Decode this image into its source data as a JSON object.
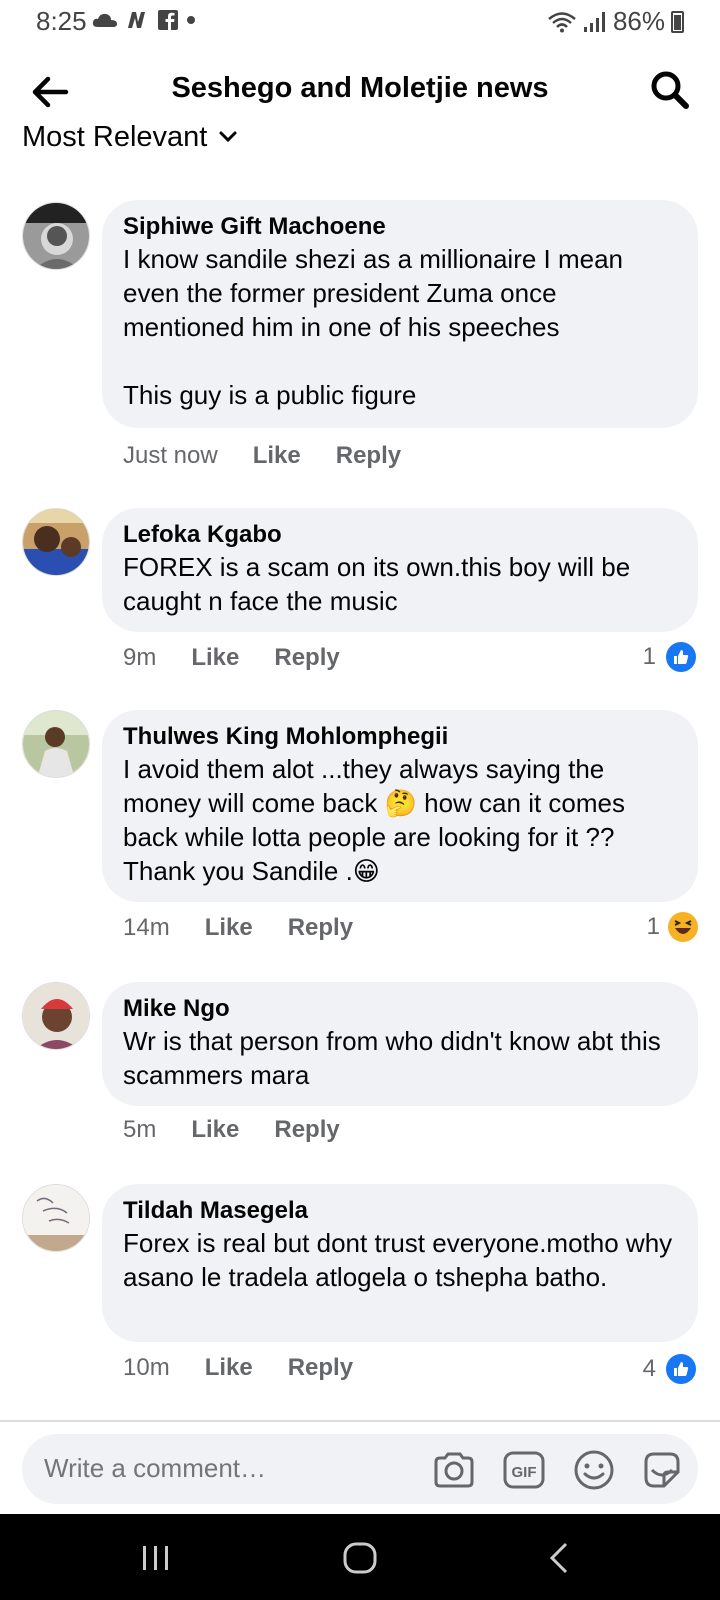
{
  "status_bar": {
    "time": "8:25",
    "battery": "86%"
  },
  "header": {
    "title": "Seshego and Moletjie news",
    "back_icon": "arrow-left-icon",
    "search_icon": "search-icon"
  },
  "sort": {
    "label": "Most Relevant"
  },
  "comments": [
    {
      "name": "Siphiwe Gift Machoene",
      "text": "I know sandile shezi as a millionaire I mean even the former president Zuma once mentioned him in one of his speeches\n\nThis guy is a public figure",
      "time": "Just now",
      "like": "Like",
      "reply": "Reply",
      "reaction_count": ""
    },
    {
      "name": "Lefoka Kgabo",
      "text": "FOREX is a scam on its own.this boy will be caught n face the music",
      "time": "9m",
      "like": "Like",
      "reply": "Reply",
      "reaction_count": "1",
      "reaction": "like"
    },
    {
      "name": "Thulwes King Mohlomphegii",
      "text": "I avoid them alot ...they always saying the money will come back 🤔 how can it comes back while lotta people are looking for it ?? Thank you Sandile .😁",
      "time": "14m",
      "like": "Like",
      "reply": "Reply",
      "reaction_count": "1",
      "reaction": "haha"
    },
    {
      "name": "Mike Ngo",
      "text": "Wr is that person from who didn't know abt this scammers mara",
      "time": "5m",
      "like": "Like",
      "reply": "Reply",
      "reaction_count": ""
    },
    {
      "name": "Tildah Masegela",
      "text": "Forex is real but dont trust everyone.motho why asano le tradela atlogela o tshepha batho.",
      "time": "10m",
      "like": "Like",
      "reply": "Reply",
      "reaction_count": "4",
      "reaction": "like"
    }
  ],
  "composer": {
    "placeholder": "Write a comment…"
  },
  "colors": {
    "accent": "#1877f2",
    "bubble": "#f0f2f5",
    "meta_text": "#65676b"
  }
}
